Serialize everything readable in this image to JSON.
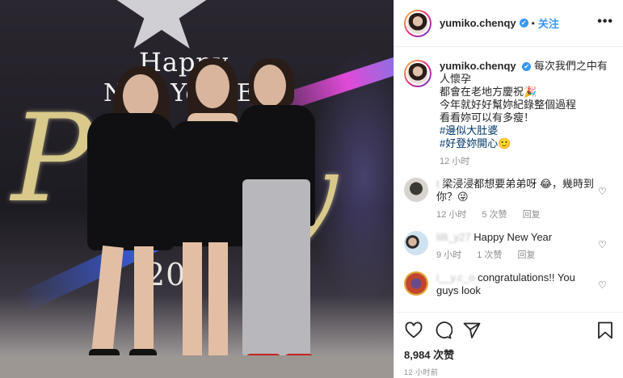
{
  "photo": {
    "sign_line1": "Happy",
    "sign_line2": "New Year Ev",
    "sign_year": "20",
    "party_left": "P",
    "party_right": "y"
  },
  "header": {
    "username": "yumiko.chenqy",
    "verified_icon": "✔",
    "separator": "•",
    "follow_label": "关注",
    "more_icon": "•••"
  },
  "caption": {
    "username": "yumiko.chenqy",
    "lines": [
      "每次我們之中有人懷孕",
      "都會在老地方慶祝🎉",
      "今年就好好幫妳紀錄整個過程",
      "看看妳可以有多瘦！"
    ],
    "hashtags": [
      "#邊似大肚婆",
      "#好登妳開心🙂"
    ],
    "time": "12 小时"
  },
  "comments": [
    {
      "user": "t",
      "text": "梁浸浸都想要弟弟呀 😂，幾時到你？😜",
      "time": "12 小时",
      "likes": "5 次赞",
      "reply": "回复"
    },
    {
      "user": "lilli_y27",
      "text": "Happy New Year",
      "time": "9 小时",
      "likes": "1 次赞",
      "reply": "回复"
    },
    {
      "user": "i__y.c_o",
      "text": "congratulations!! You guys look",
      "time": "",
      "likes": "",
      "reply": ""
    }
  ],
  "actions": {
    "likes_count": "8,984 次赞",
    "timestamp": "12 小时前"
  },
  "colors": {
    "link": "#3897f0",
    "hashtag": "#003569",
    "meta": "#8e8e8e"
  }
}
